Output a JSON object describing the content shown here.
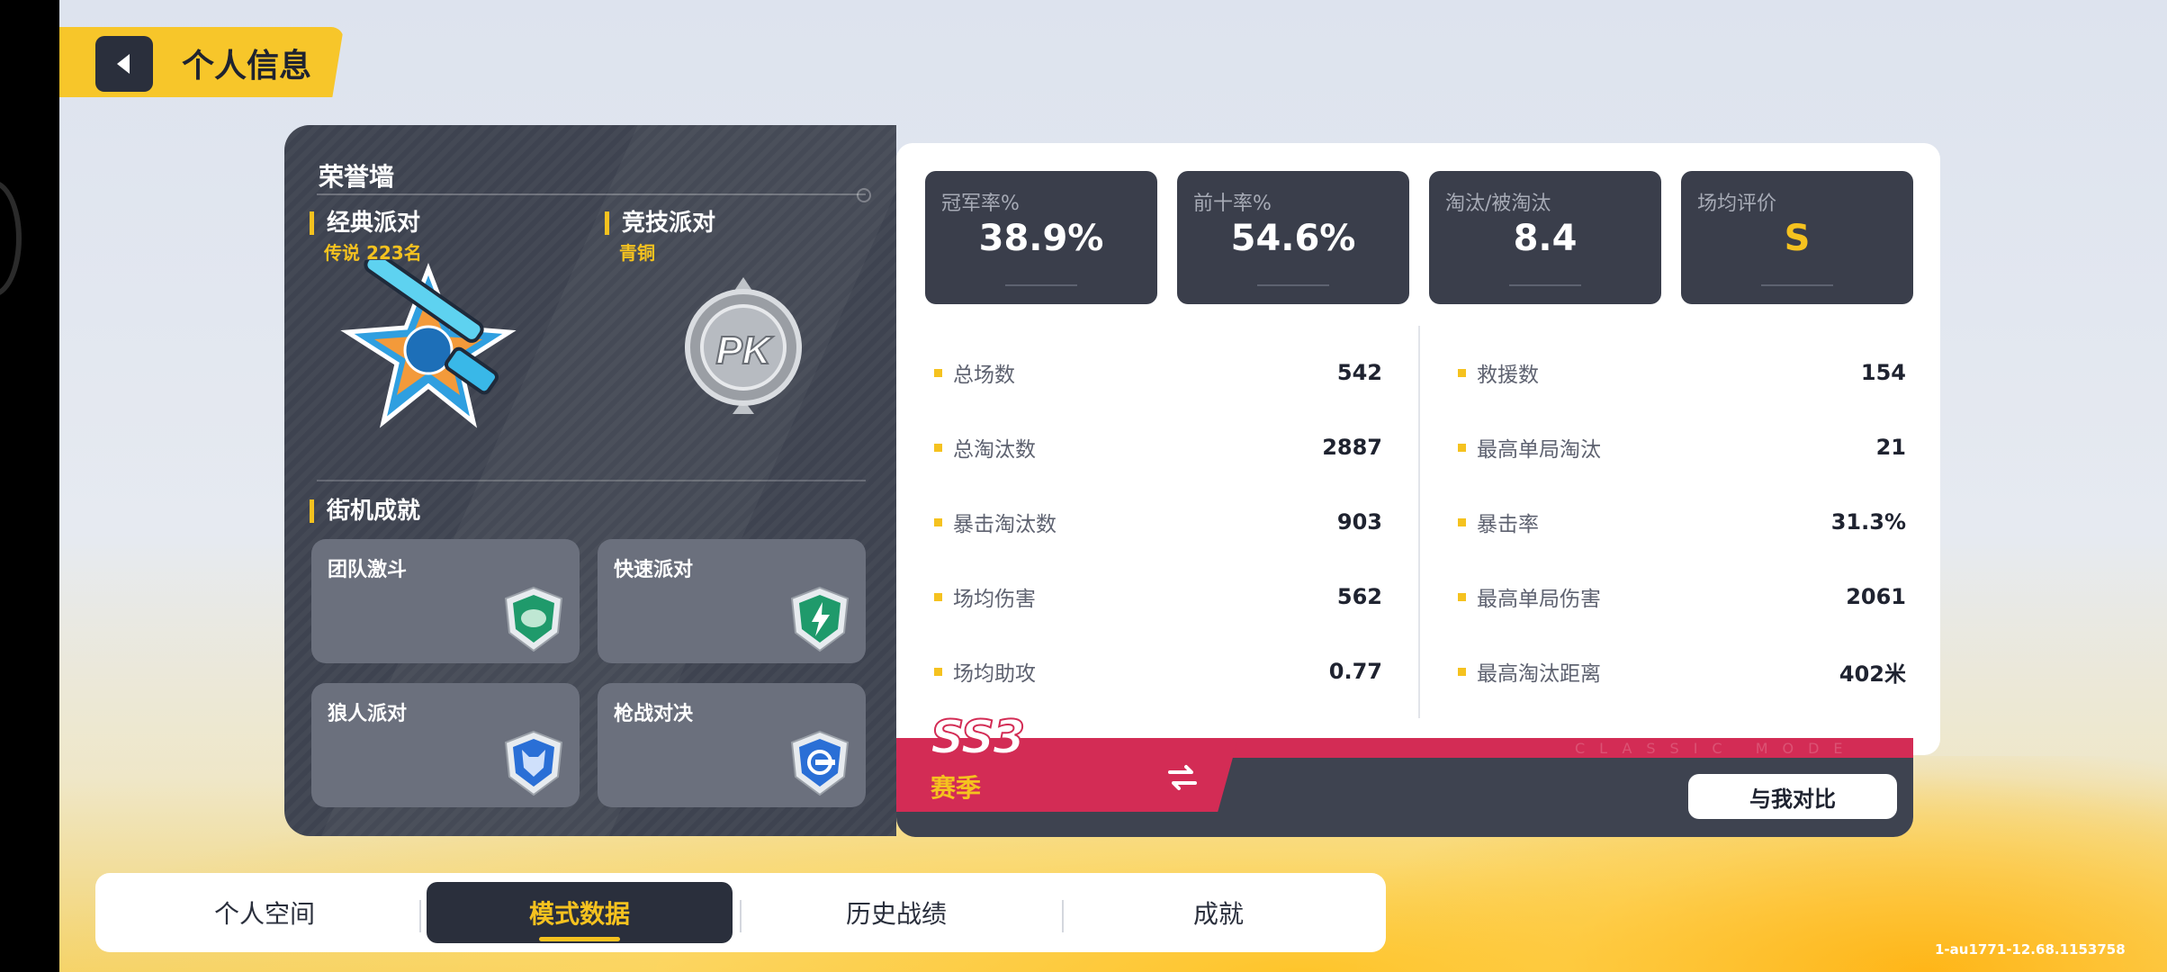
{
  "header": {
    "title": "个人信息"
  },
  "honor": {
    "title": "荣誉墙",
    "classic": {
      "label": "经典派对",
      "rank": "传说 223名"
    },
    "competitive": {
      "label": "竞技派对",
      "rank": "青铜",
      "emblem_text": "PK"
    },
    "arcade_title": "街机成就",
    "arcade": [
      {
        "label": "团队激斗"
      },
      {
        "label": "快速派对"
      },
      {
        "label": "狼人派对"
      },
      {
        "label": "枪战对决"
      }
    ]
  },
  "stats": {
    "boxes": [
      {
        "caption": "冠军率%",
        "value": "38.9%"
      },
      {
        "caption": "前十率%",
        "value": "54.6%"
      },
      {
        "caption": "淘汰/被淘汰",
        "value": "8.4"
      },
      {
        "caption": "场均评价",
        "value": "S"
      }
    ],
    "left_rows": [
      {
        "key": "总场数",
        "value": "542"
      },
      {
        "key": "总淘汰数",
        "value": "2887"
      },
      {
        "key": "暴击淘汰数",
        "value": "903"
      },
      {
        "key": "场均伤害",
        "value": "562"
      },
      {
        "key": "场均助攻",
        "value": "0.77"
      }
    ],
    "right_rows": [
      {
        "key": "救援数",
        "value": "154"
      },
      {
        "key": "最高单局淘汰",
        "value": "21"
      },
      {
        "key": "暴击率",
        "value": "31.3%"
      },
      {
        "key": "最高单局伤害",
        "value": "2061"
      },
      {
        "key": "最高淘汰距离",
        "value": "402米"
      }
    ]
  },
  "season": {
    "code": "SS3",
    "label": "赛季",
    "watermark": "CLASSIC MODE",
    "compare_label": "与我对比"
  },
  "tabs": [
    {
      "label": "个人空间",
      "active": false
    },
    {
      "label": "模式数据",
      "active": true
    },
    {
      "label": "历史战绩",
      "active": false
    },
    {
      "label": "成就",
      "active": false
    }
  ],
  "version": "1-au1771-12.68.1153758",
  "colors": {
    "accent": "#f5c21f",
    "panel": "#3e4350",
    "season_red": "#d32c55"
  },
  "icons": {
    "back": "back-arrow-icon",
    "classic_emblem": "legend-star-emblem-icon",
    "competitive_emblem": "pk-bronze-emblem-icon",
    "swap": "swap-arrows-icon"
  }
}
